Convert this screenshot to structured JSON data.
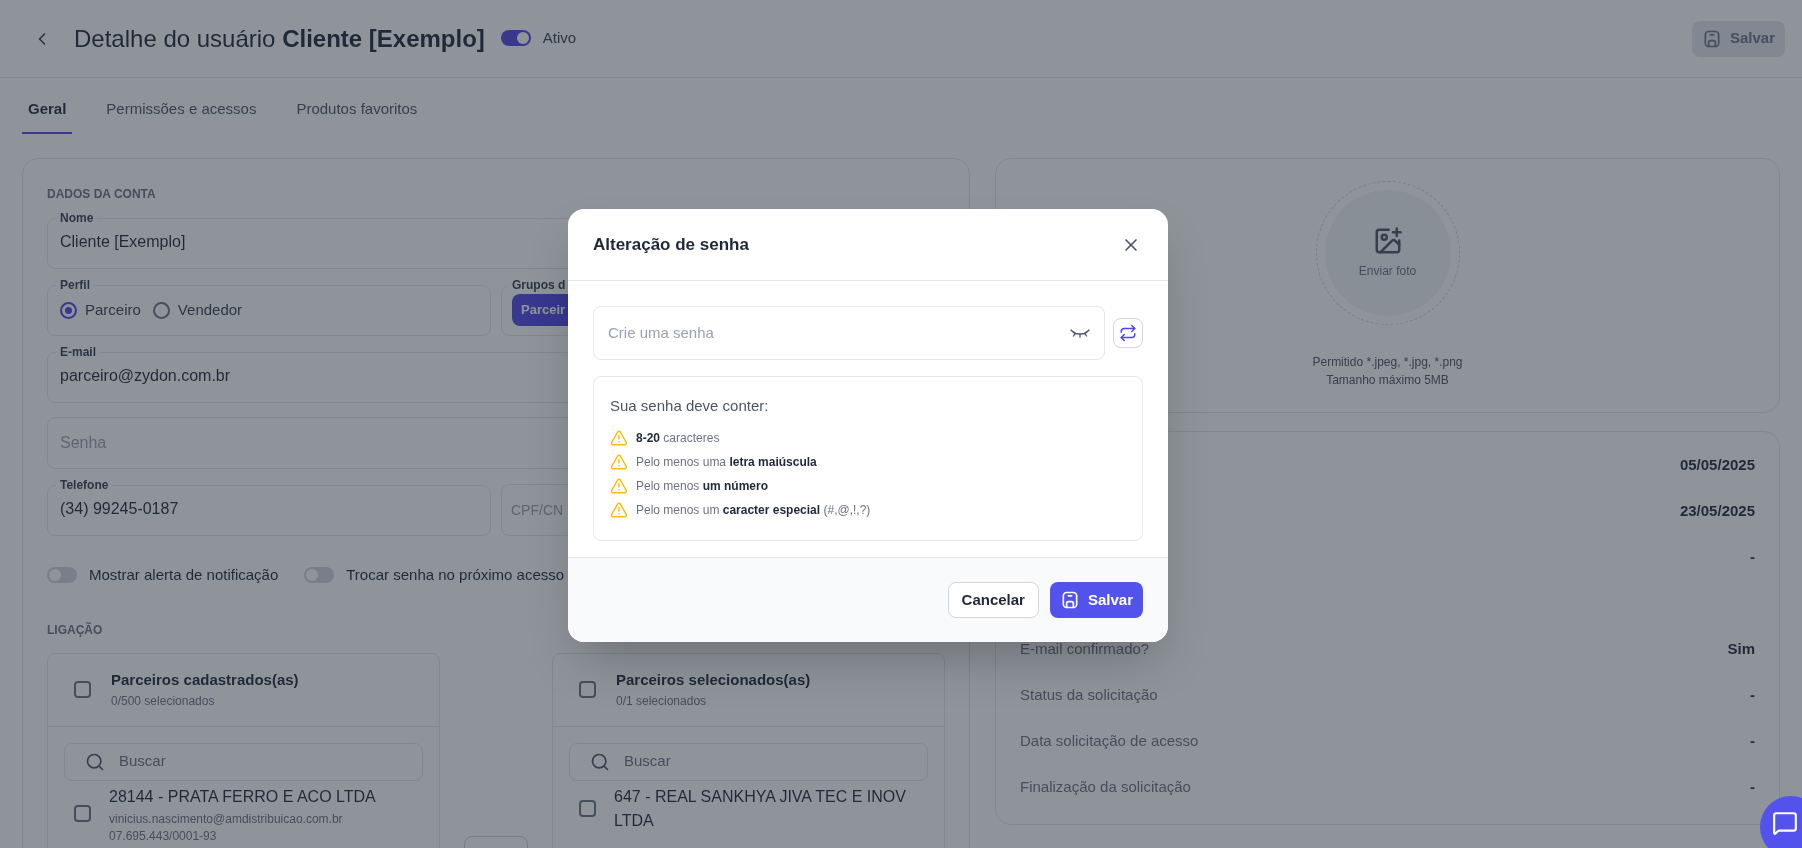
{
  "header": {
    "title": "Detalhe do usuário **Cliente [Exemplo]**",
    "active_toggle": {
      "label": "Ativo",
      "on": true
    },
    "save_button": {
      "label": "Salvar",
      "disabled": true
    }
  },
  "tabs": [
    {
      "label": "Geral",
      "selected": true
    },
    {
      "label": "Permissões e acessos",
      "selected": false
    },
    {
      "label": "Produtos favoritos",
      "selected": false
    }
  ],
  "account": {
    "heading": "DADOS DA CONTA",
    "name": {
      "label": "Nome",
      "value": "Cliente [Exemplo]"
    },
    "profile": {
      "label": "Perfil",
      "options": [
        {
          "label": "Parceiro",
          "selected": true
        },
        {
          "label": "Vendedor",
          "selected": false
        }
      ]
    },
    "groups": {
      "label": "Grupos d",
      "chips": [
        "Parceir"
      ]
    },
    "email": {
      "label": "E-mail",
      "value": "parceiro@zydon.com.br"
    },
    "password": {
      "placeholder": "Senha"
    },
    "phone": {
      "label": "Telefone",
      "value": "(34) 99245-0187"
    },
    "document": {
      "placeholder": "CPF/CN"
    },
    "switches": [
      {
        "label": "Mostrar alerta de notificação",
        "on": false
      },
      {
        "label": "Trocar senha no próximo acesso",
        "on": false
      }
    ]
  },
  "link": {
    "heading": "LIGAÇÃO",
    "lists": [
      {
        "title": "Parceiros cadastrados(as)",
        "count": "0/500 selecionados",
        "checked": false,
        "search_placeholder": "Buscar",
        "items": [
          {
            "name": "28144 - PRATA FERRO E ACO LTDA",
            "email": "vinicius.nascimento@amdistribuicao.com.br",
            "document": "07.695.443/0001-93",
            "checked": false
          }
        ]
      },
      {
        "title": "Parceiros selecionados(as)",
        "count": "0/1 selecionados",
        "checked": false,
        "search_placeholder": "Buscar",
        "items": [
          {
            "name": "647 - REAL SANKHYA JIVA TEC E INOV LTDA",
            "checked": false
          }
        ]
      }
    ]
  },
  "photo": {
    "button_label": "Enviar foto",
    "allowed": "Permitido *.jpeg, *.jpg, *.png",
    "max_size": "Tamanho máximo 5MB"
  },
  "info_rows": [
    {
      "value": "05/05/2025"
    },
    {
      "value": "23/05/2025"
    },
    {
      "value": "-"
    },
    {
      "label": "E-mail confirmado?",
      "value": "Sim"
    },
    {
      "label": "Status da solicitação",
      "value": "-"
    },
    {
      "label": "Data solicitação de acesso",
      "value": "-"
    },
    {
      "label": "Finalização da solicitação",
      "value": "-"
    }
  ],
  "modal": {
    "title": "Alteração de senha",
    "password_placeholder": "Crie uma senha",
    "requirements_title": "Sua senha deve conter:",
    "requirements": [
      {
        "text": "**8-20** caracteres",
        "met": false
      },
      {
        "text": "Pelo menos uma **letra maiúscula**",
        "met": false
      },
      {
        "text": "Pelo menos **um número**",
        "met": false
      },
      {
        "text": "Pelo menos um **caracter especial** (#,@,!,?)",
        "met": false
      }
    ],
    "cancel_label": "Cancelar",
    "save_label": "Salvar"
  }
}
